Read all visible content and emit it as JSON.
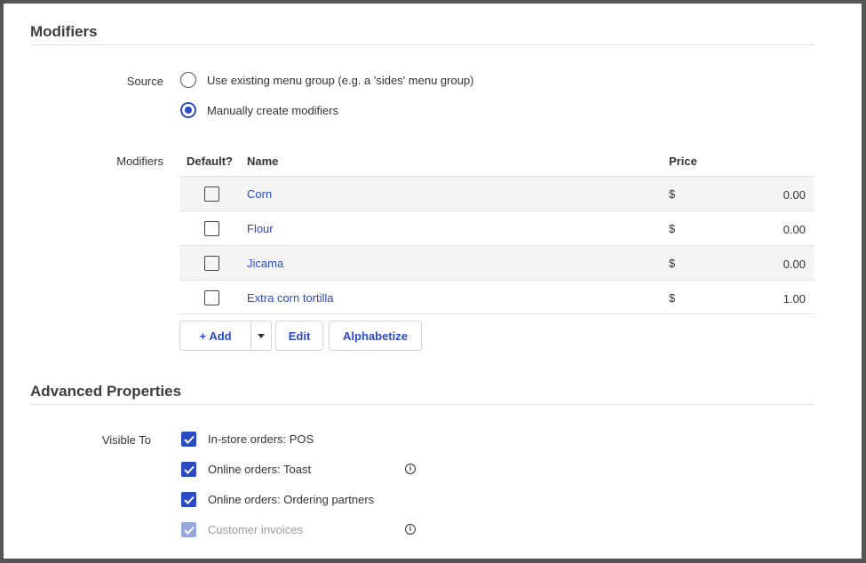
{
  "modifiers_section": {
    "title": "Modifiers",
    "source_label": "Source",
    "source_options": [
      {
        "label": "Use existing menu group (e.g. a 'sides' menu group)",
        "selected": false
      },
      {
        "label": "Manually create modifiers",
        "selected": true
      }
    ],
    "modifiers_label": "Modifiers",
    "table": {
      "headers": {
        "default": "Default?",
        "name": "Name",
        "price": "Price"
      },
      "rows": [
        {
          "name": "Corn",
          "currency": "$",
          "price": "0.00",
          "default": false
        },
        {
          "name": "Flour",
          "currency": "$",
          "price": "0.00",
          "default": false
        },
        {
          "name": "Jicama",
          "currency": "$",
          "price": "0.00",
          "default": false
        },
        {
          "name": "Extra corn tortilla",
          "currency": "$",
          "price": "1.00",
          "default": false
        }
      ]
    },
    "buttons": {
      "add": "+ Add",
      "edit": "Edit",
      "alphabetize": "Alphabetize"
    }
  },
  "advanced_section": {
    "title": "Advanced Properties",
    "visible_to_label": "Visible To",
    "options": [
      {
        "label": "In-store orders: POS",
        "checked": true,
        "disabled": false,
        "info": false
      },
      {
        "label": "Online orders: Toast",
        "checked": true,
        "disabled": false,
        "info": true
      },
      {
        "label": "Online orders: Ordering partners",
        "checked": true,
        "disabled": false,
        "info": false
      },
      {
        "label": "Customer invoices",
        "checked": true,
        "disabled": true,
        "info": true
      }
    ]
  },
  "icons": [
    "radio-icon",
    "checkbox-icon",
    "check-icon",
    "chevron-down-icon",
    "info-icon"
  ],
  "colors": {
    "accent": "#2b4ac5",
    "disabled_check": "#96a7e0",
    "row_shade": "#f5f5f5"
  }
}
